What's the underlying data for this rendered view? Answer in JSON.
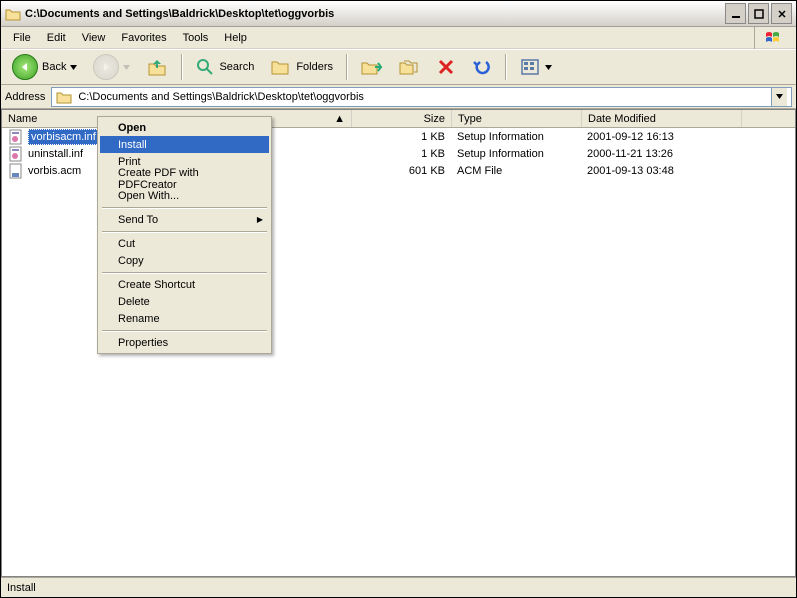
{
  "window": {
    "title": "C:\\Documents and Settings\\Baldrick\\Desktop\\tet\\oggvorbis"
  },
  "menubar": {
    "file": "File",
    "edit": "Edit",
    "view": "View",
    "favorites": "Favorites",
    "tools": "Tools",
    "help": "Help"
  },
  "toolbar": {
    "back": "Back",
    "search": "Search",
    "folders": "Folders"
  },
  "addressbar": {
    "label": "Address",
    "path": "C:\\Documents and Settings\\Baldrick\\Desktop\\tet\\oggvorbis"
  },
  "columns": {
    "name": "Name",
    "size": "Size",
    "type": "Type",
    "date": "Date Modified"
  },
  "files": [
    {
      "name": "vorbisacm.inf",
      "size": "1 KB",
      "type": "Setup Information",
      "date": "2001-09-12 16:13",
      "selected": true
    },
    {
      "name": "uninstall.inf",
      "size": "1 KB",
      "type": "Setup Information",
      "date": "2000-11-21 13:26",
      "selected": false
    },
    {
      "name": "vorbis.acm",
      "size": "601 KB",
      "type": "ACM File",
      "date": "2001-09-13 03:48",
      "selected": false
    }
  ],
  "context_menu": {
    "open": "Open",
    "install": "Install",
    "print": "Print",
    "pdf": "Create PDF with PDFCreator",
    "open_with": "Open With...",
    "send_to": "Send To",
    "cut": "Cut",
    "copy": "Copy",
    "create_shortcut": "Create Shortcut",
    "delete": "Delete",
    "rename": "Rename",
    "properties": "Properties"
  },
  "statusbar": {
    "text": "Install"
  }
}
